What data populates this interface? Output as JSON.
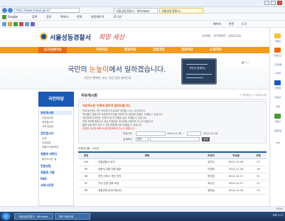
{
  "browser": {
    "address_url": "http://www.smpol.go.kr/",
    "tabs": [
      {
        "label": "서울성동경찰서 - Windows"
      },
      {
        "label": "서울성동경찰서..."
      }
    ],
    "toolbar1": {
      "search_label": "Google",
      "item1": "검색",
      "item2": "공유",
      "item3": "북마크",
      "item4": "번역",
      "item5": "자동채우기",
      "item6": "로그인"
    },
    "toolbar2": {
      "item1": "페이지",
      "item2": "안전",
      "item3": "도구"
    },
    "zoom": "100%"
  },
  "site": {
    "logo_text": "서울성동경찰서",
    "logo_script": "희망 세상",
    "util_links": "HOME · SITEMAP · ENGLISH"
  },
  "gnb": {
    "home": "신고민원마당",
    "items": [
      "국민마당",
      "홍보마당",
      "알림마당",
      "정보마당",
      "소개마당"
    ]
  },
  "hero": {
    "title_pre": "국민의 ",
    "title_accent": "눈높이",
    "title_post": "에서 일하겠습니다.",
    "subtitle": "국민이 행복한 나라, 치안 일류 대한민국",
    "illust_caption": "국민과 함께하는"
  },
  "lnb": {
    "title": "국민마당",
    "groups": [
      {
        "label": "자유게시판",
        "on": true
      },
      {
        "label": "칭찬합시다",
        "on": false
      },
      {
        "label": "경찰에 바란다",
        "on": false
      },
      {
        "label": "민원상담",
        "on": false
      },
      {
        "label": "경찰관 고발",
        "on": false
      },
      {
        "label": "FAQ",
        "on": false
      },
      {
        "label": "서비스헌장",
        "on": false
      }
    ],
    "subs": [
      "자유게시판",
      "칭찬합시다",
      "사이버상담",
      "소개",
      "주요업무",
      "포돌이 캐리커처",
      "찾아오시는 길"
    ]
  },
  "main": {
    "page_title": "자유게시판",
    "breadcrumb": "> 국민마당 > 자유게시판",
    "notice_head": "자유게시판 이용에 관하여 알려드립니다.",
    "notice_lines": [
      "자유게시판은 국민 여러분의 자유로운 의견을 나누는 공간입니다.",
      "게시물은 실명으로 작성되며 타인을 비방하거나 음란한 내용은 삭제될 수 있습니다.",
      "개인정보(주민번호, 연락처 등)가 포함된 글은 삭제될 수 있습니다.",
      "민원 처리를 원하시는 분은 민원상담 게시판을 이용하여 주시기 바랍니다.",
      "불법·유해 정보 게시 시 관련 법령에 따라 처벌될 수 있습니다."
    ],
    "notice_red": "건전한 게시판 문화 조성에 협조하여 주시기 바랍니다.",
    "search": {
      "period_label": "작성기간",
      "date_from": "2014-11-18",
      "date_to": "2014-11-18",
      "field_label": "검색조건",
      "field_value": "제목",
      "button": "검색"
    },
    "total": "전체게시물 : 100건",
    "columns": [
      "번호",
      "제목",
      "작성자",
      "작성일",
      "조회"
    ],
    "rows": [
      {
        "no": "100",
        "title": "성동경찰서 감사",
        "author": "김민수",
        "date": "2014-11-18",
        "views": "23"
      },
      {
        "no": "99",
        "title": "성동서 교통 민원 질문",
        "author": "이영희",
        "date": "2014-11-18",
        "views": "18"
      },
      {
        "no": "98",
        "title": "치안 서비스 개선 건의",
        "author": "박지훈",
        "date": "2014-11-17",
        "views": "31"
      },
      {
        "no": "97",
        "title": "관내 순찰 강화 요청",
        "author": "최수진",
        "date": "2014-11-17",
        "views": "27"
      },
      {
        "no": "96",
        "title": "경찰관께 감사드립니다",
        "author": "정하늘",
        "date": "2014-11-16",
        "views": "19"
      }
    ]
  },
  "sidebar": {
    "items": [
      "퀵메뉴",
      "민원신고",
      "고객만족",
      "사이버",
      "경찰청",
      "민원24",
      "알림",
      "성동구",
      "교통정보",
      "TOP"
    ]
  },
  "taskbar": {
    "tasks": [
      "서울성동경찰서 - Windows",
      "정보 제공자료"
    ],
    "tray": "오후 2:17"
  },
  "colors": {
    "gnb": "#f39a1a",
    "gnb_home": "#e96a10",
    "lnb_title": "#1c58b4",
    "accent": "#e05a12"
  }
}
